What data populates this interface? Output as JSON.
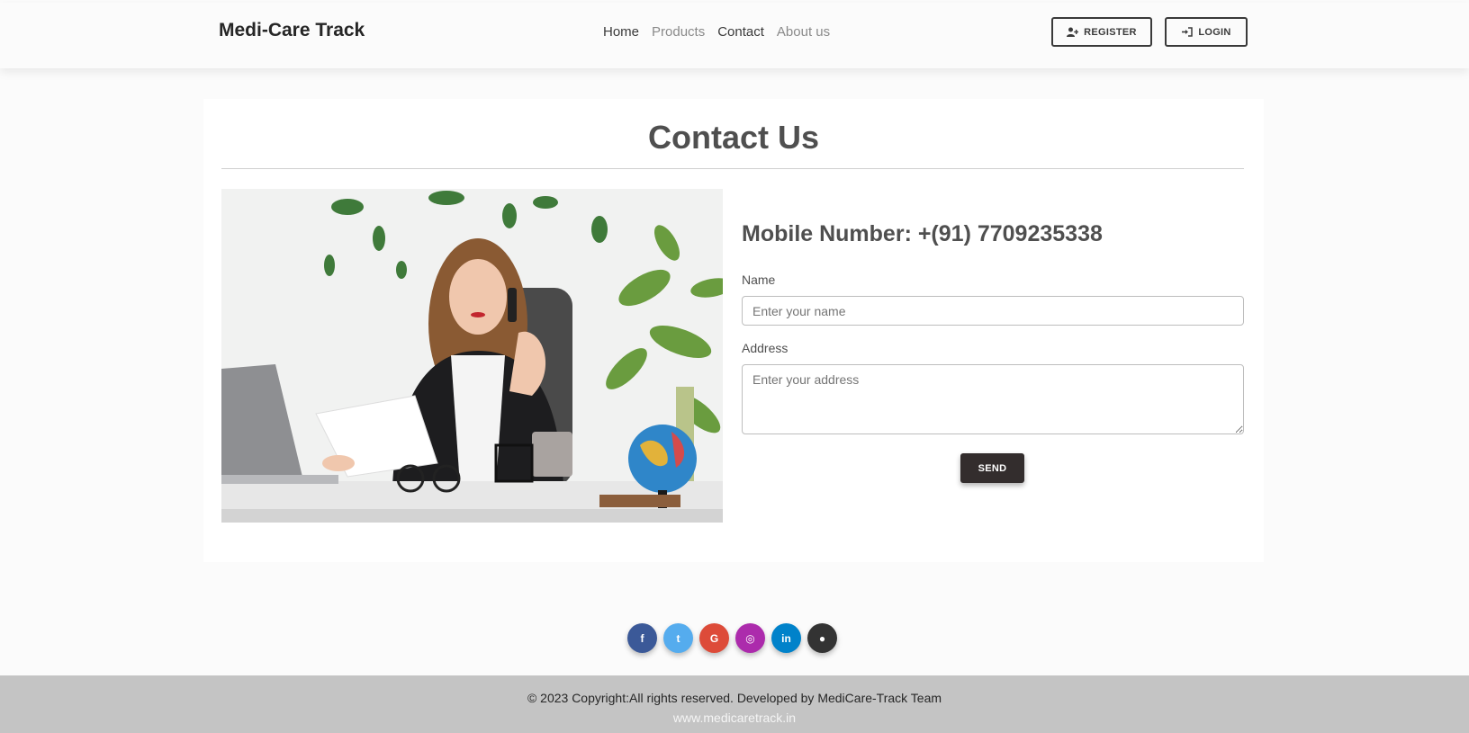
{
  "navbar": {
    "brand": "Medi-Care Track",
    "links": [
      {
        "label": "Home",
        "color": "#3a3a3a"
      },
      {
        "label": "Products",
        "color": "#8a8a8a"
      },
      {
        "label": "Contact",
        "color": "#3a3a3a"
      },
      {
        "label": "About us",
        "color": "#8a8a8a"
      }
    ],
    "register_label": "REGISTER",
    "login_label": "LOGIN"
  },
  "contact": {
    "title": "Contact Us",
    "mobile": "Mobile Number: +(91) 7709235338",
    "name_label": "Name",
    "name_placeholder": "Enter your name",
    "address_label": "Address",
    "address_placeholder": "Enter your address",
    "send_label": "SEND"
  },
  "social": [
    {
      "icon": "facebook-icon",
      "glyph": "f",
      "color": "#3b5998"
    },
    {
      "icon": "twitter-icon",
      "glyph": "t",
      "color": "#55acee"
    },
    {
      "icon": "google-icon",
      "glyph": "G",
      "color": "#dd4b39"
    },
    {
      "icon": "instagram-icon",
      "glyph": "◎",
      "color": "#ac2bac"
    },
    {
      "icon": "linkedin-icon",
      "glyph": "in",
      "color": "#0082ca"
    },
    {
      "icon": "github-icon",
      "glyph": "●",
      "color": "#333333"
    }
  ],
  "footer": {
    "copyright": "© 2023 Copyright:All rights reserved. Developed by MediCare-Track Team",
    "site": "www.medicaretrack.in"
  }
}
